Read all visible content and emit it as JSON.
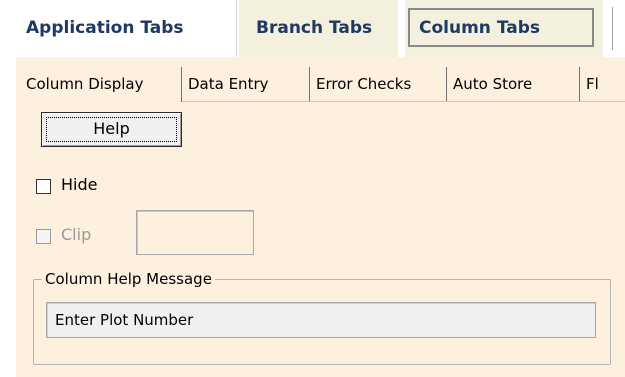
{
  "top_tabs": {
    "application": "Application Tabs",
    "branch": "Branch Tabs",
    "column": "Column Tabs",
    "selected": "Column Tabs"
  },
  "sub_tabs": {
    "items": [
      "Column Display",
      "Data Entry",
      "Error Checks",
      "Auto Store",
      "Fl"
    ],
    "selected": "Column Display"
  },
  "column_display": {
    "help_button": "Help",
    "hide": {
      "label": "Hide",
      "checked": false
    },
    "clip": {
      "label": "Clip",
      "checked": false,
      "enabled": false,
      "value": ""
    },
    "help_message_group": {
      "legend": "Column Help Message",
      "value": "Enter Plot Number"
    }
  },
  "colors": {
    "panel_bg": "#fdf0de",
    "tab_text": "#1f3864",
    "tab_active_bg": "#f3f1dd"
  }
}
